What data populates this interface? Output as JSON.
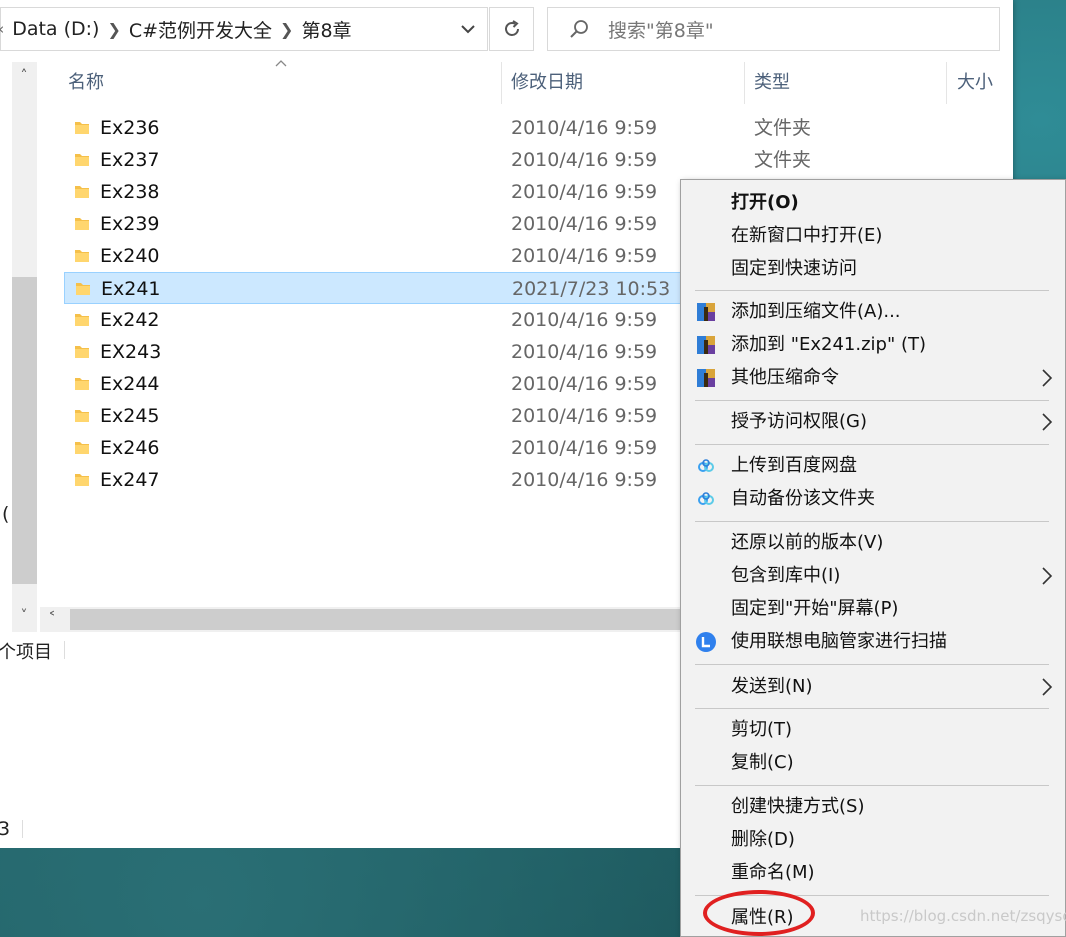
{
  "address": {
    "crumbs": [
      "Data (D:)",
      "C#范例开发大全",
      "第8章"
    ],
    "prefix_glyph": "«"
  },
  "search": {
    "placeholder": "搜索\"第8章\""
  },
  "columns": {
    "name": "名称",
    "date": "修改日期",
    "type": "类型",
    "size": "大小"
  },
  "files": [
    {
      "name": "Ex236",
      "date": "2010/4/16 9:59",
      "type": "文件夹",
      "selected": false
    },
    {
      "name": "Ex237",
      "date": "2010/4/16 9:59",
      "type": "文件夹",
      "selected": false
    },
    {
      "name": "Ex238",
      "date": "2010/4/16 9:59",
      "type": "",
      "selected": false
    },
    {
      "name": "Ex239",
      "date": "2010/4/16 9:59",
      "type": "",
      "selected": false
    },
    {
      "name": "Ex240",
      "date": "2010/4/16 9:59",
      "type": "",
      "selected": false
    },
    {
      "name": "Ex241",
      "date": "2021/7/23 10:53",
      "type": "",
      "selected": true
    },
    {
      "name": "Ex242",
      "date": "2010/4/16 9:59",
      "type": "",
      "selected": false
    },
    {
      "name": "EX243",
      "date": "2010/4/16 9:59",
      "type": "",
      "selected": false
    },
    {
      "name": "Ex244",
      "date": "2010/4/16 9:59",
      "type": "",
      "selected": false
    },
    {
      "name": "Ex245",
      "date": "2010/4/16 9:59",
      "type": "",
      "selected": false
    },
    {
      "name": "Ex246",
      "date": "2010/4/16 9:59",
      "type": "",
      "selected": false
    },
    {
      "name": "Ex247",
      "date": "2010/4/16 9:59",
      "type": "",
      "selected": false
    }
  ],
  "status": {
    "items_text": "个项目"
  },
  "left_fragments": {
    "paren": "(",
    "lower": "3"
  },
  "context_menu": {
    "items": [
      {
        "label": "打开(O)",
        "bold": true,
        "icon": "",
        "submenu": false
      },
      {
        "label": "在新窗口中打开(E)",
        "icon": "",
        "submenu": false
      },
      {
        "label": "固定到快速访问",
        "icon": "",
        "submenu": false
      },
      {
        "label": "添加到压缩文件(A)...",
        "icon": "winrar-icon",
        "submenu": false
      },
      {
        "label": "添加到 \"Ex241.zip\" (T)",
        "icon": "winrar-icon",
        "submenu": false
      },
      {
        "label": "其他压缩命令",
        "icon": "winrar-icon",
        "submenu": true
      },
      {
        "label": "授予访问权限(G)",
        "icon": "",
        "submenu": true
      },
      {
        "label": "上传到百度网盘",
        "icon": "baidu-netdisk-icon",
        "submenu": false
      },
      {
        "label": "自动备份该文件夹",
        "icon": "baidu-netdisk-icon",
        "submenu": false
      },
      {
        "label": "还原以前的版本(V)",
        "icon": "",
        "submenu": false
      },
      {
        "label": "包含到库中(I)",
        "icon": "",
        "submenu": true
      },
      {
        "label": "固定到\"开始\"屏幕(P)",
        "icon": "",
        "submenu": false
      },
      {
        "label": "使用联想电脑管家进行扫描",
        "icon": "lenovo-icon",
        "submenu": false
      },
      {
        "label": "发送到(N)",
        "icon": "",
        "submenu": true
      },
      {
        "label": "剪切(T)",
        "icon": "",
        "submenu": false
      },
      {
        "label": "复制(C)",
        "icon": "",
        "submenu": false
      },
      {
        "label": "创建快捷方式(S)",
        "icon": "",
        "submenu": false
      },
      {
        "label": "删除(D)",
        "icon": "",
        "submenu": false
      },
      {
        "label": "重命名(M)",
        "icon": "",
        "submenu": false
      },
      {
        "label": "属性(R)",
        "icon": "",
        "submenu": false
      }
    ]
  },
  "watermark": "https://blog.csdn.net/zsqysq",
  "colors": {
    "selection": "#cce8ff",
    "highlight_circle": "#e02020",
    "folder": "#f5c04a"
  }
}
